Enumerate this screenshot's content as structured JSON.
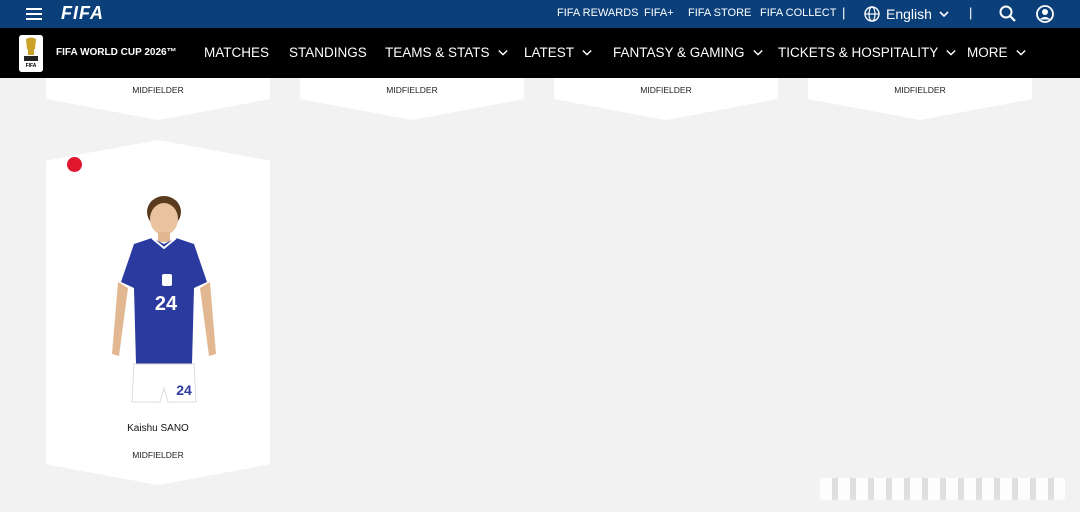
{
  "topbar": {
    "logo": "FIFA",
    "links": [
      "FIFA REWARDS",
      "FIFA+",
      "FIFA STORE",
      "FIFA COLLECT"
    ],
    "separator": "|",
    "language": "English"
  },
  "nav": {
    "event_title": "FIFA WORLD CUP 2026™",
    "logo_text": "FIFA",
    "items": [
      {
        "label": "MATCHES",
        "dropdown": false
      },
      {
        "label": "STANDINGS",
        "dropdown": false
      },
      {
        "label": "TEAMS & STATS",
        "dropdown": true
      },
      {
        "label": "LATEST",
        "dropdown": true
      },
      {
        "label": "FANTASY & GAMING",
        "dropdown": true
      },
      {
        "label": "TICKETS & HOSPITALITY",
        "dropdown": true
      },
      {
        "label": "MORE",
        "dropdown": true
      }
    ]
  },
  "cards_top": [
    {
      "position": "MIDFIELDER"
    },
    {
      "position": "MIDFIELDER"
    },
    {
      "position": "MIDFIELDER"
    },
    {
      "position": "MIDFIELDER"
    }
  ],
  "player_card": {
    "name": "Kaishu SANO",
    "position": "MIDFIELDER",
    "shirt_number": "24",
    "flag_color": "#e0172f",
    "kit_color": "#2b3a9e"
  },
  "colors": {
    "topbar": "#0b3f7a",
    "navbar": "#000000",
    "page_bg": "#f2f2f3"
  }
}
